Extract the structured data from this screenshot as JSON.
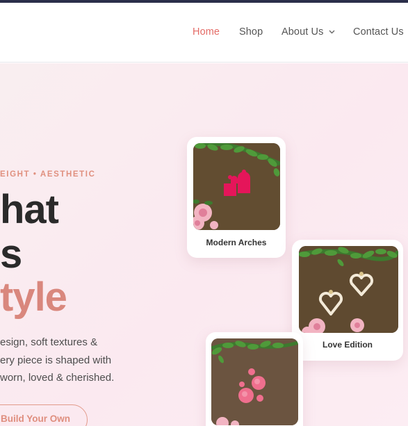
{
  "nav": {
    "items": [
      {
        "label": "Home",
        "active": true
      },
      {
        "label": "Shop",
        "active": false
      },
      {
        "label": "About Us",
        "active": false,
        "has_dropdown": true
      },
      {
        "label": "Contact Us",
        "active": false
      }
    ]
  },
  "hero": {
    "eyebrow": "EIGHT • AESTHETIC",
    "headline_line1": "hat",
    "headline_line2": "s",
    "headline_line3": "tyle",
    "paragraph_lines": [
      "esign, soft textures &",
      "ery piece is shaped with",
      "worn, loved & cherished."
    ],
    "cta_label": "Build Your Own"
  },
  "cards": [
    {
      "caption": "Modern Arches"
    },
    {
      "caption": "Love Edition"
    },
    {
      "caption": ""
    }
  ],
  "colors": {
    "accent": "#e46b66",
    "heading": "#2a2a2a",
    "highlight": "#d9877d",
    "hero_background": "#fbe9f0",
    "top_bar": "#2b2f4a"
  }
}
